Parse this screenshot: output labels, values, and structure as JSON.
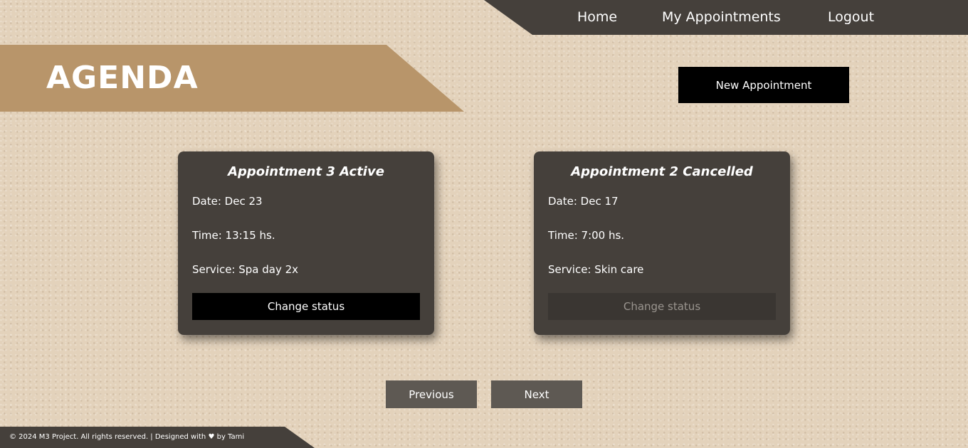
{
  "nav": {
    "home": "Home",
    "appointments": "My Appointments",
    "logout": "Logout"
  },
  "header": {
    "title": "AGENDA",
    "new_appointment": "New Appointment"
  },
  "appointments": [
    {
      "title": "Appointment 3 Active",
      "date": "Date: Dec 23",
      "time": "Time: 13:15 hs.",
      "service": "Service: Spa day 2x",
      "action": "Change status",
      "action_enabled": true
    },
    {
      "title": "Appointment 2 Cancelled",
      "date": "Date: Dec 17",
      "time": "Time: 7:00 hs.",
      "service": "Service: Skin care",
      "action": "Change status",
      "action_enabled": false
    }
  ],
  "pagination": {
    "previous": "Previous",
    "next": "Next"
  },
  "footer": {
    "text": "© 2024 M3 Project. All rights reserved. | Designed with ♥ by Tami"
  },
  "colors": {
    "background": "#e3d2bb",
    "dark_panel": "#45403b",
    "banner": "#b8956a",
    "button": "#000000",
    "pagination_button": "#5e5953"
  }
}
